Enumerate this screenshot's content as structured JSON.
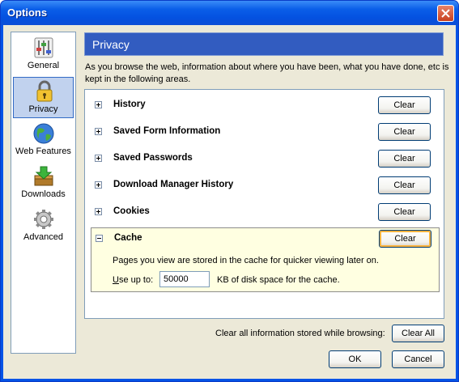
{
  "window": {
    "title": "Options"
  },
  "sidebar": {
    "items": [
      {
        "label": "General",
        "icon": "general-icon"
      },
      {
        "label": "Privacy",
        "icon": "lock-icon",
        "selected": true
      },
      {
        "label": "Web Features",
        "icon": "globe-icon"
      },
      {
        "label": "Downloads",
        "icon": "downloads-icon"
      },
      {
        "label": "Advanced",
        "icon": "gear-icon"
      }
    ]
  },
  "main": {
    "header": "Privacy",
    "description": "As you browse the web, information about where you have been, what you have done, etc is kept in the following areas.",
    "items": [
      {
        "name": "History",
        "button": "Clear"
      },
      {
        "name": "Saved Form Information",
        "button": "Clear"
      },
      {
        "name": "Saved Passwords",
        "button": "Clear"
      },
      {
        "name": "Download Manager History",
        "button": "Clear"
      },
      {
        "name": "Cookies",
        "button": "Clear"
      },
      {
        "name": "Cache",
        "button": "Clear",
        "expanded": true
      }
    ],
    "cache": {
      "description": "Pages you view are stored in the cache for quicker viewing later on.",
      "useup_label_u": "U",
      "useup_label_rest": "se up to:",
      "value": "50000",
      "unit_label": "KB of disk space for the cache."
    },
    "clear_all_label": "Clear all information stored while browsing:",
    "clear_all_button": "Clear All"
  },
  "footer": {
    "ok": "OK",
    "cancel": "Cancel"
  },
  "colors": {
    "titlebar": "#0a5ee8",
    "header": "#325cc0",
    "selection": "#c1d2ee",
    "cache_highlight": "#ffffe1"
  }
}
